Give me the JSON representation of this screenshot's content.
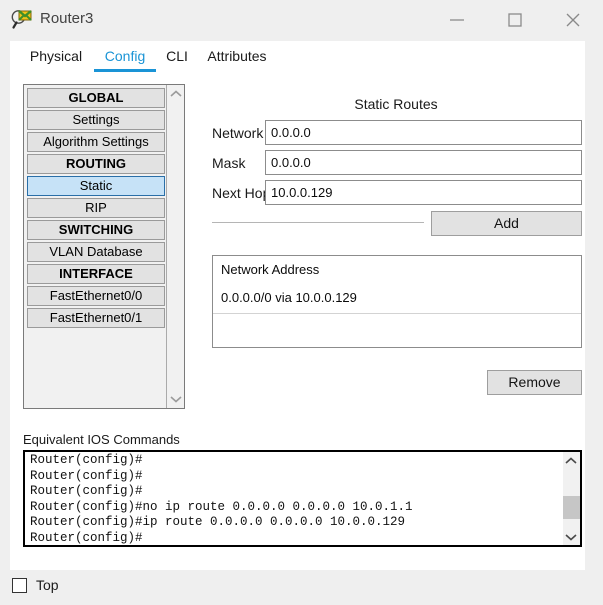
{
  "window": {
    "title": "Router3",
    "icon": "packet-tracer-icon",
    "controls": {
      "minimize": "minimize-icon",
      "maximize": "maximize-icon",
      "close": "close-icon"
    }
  },
  "tabs": [
    {
      "label": "Physical",
      "active": false
    },
    {
      "label": "Config",
      "active": true
    },
    {
      "label": "CLI",
      "active": false
    },
    {
      "label": "Attributes",
      "active": false
    }
  ],
  "sidebar": {
    "items": [
      {
        "label": "GLOBAL",
        "type": "header",
        "selected": false
      },
      {
        "label": "Settings",
        "type": "item",
        "selected": false
      },
      {
        "label": "Algorithm Settings",
        "type": "item",
        "selected": false
      },
      {
        "label": "ROUTING",
        "type": "header",
        "selected": false
      },
      {
        "label": "Static",
        "type": "item",
        "selected": true
      },
      {
        "label": "RIP",
        "type": "item",
        "selected": false
      },
      {
        "label": "SWITCHING",
        "type": "header",
        "selected": false
      },
      {
        "label": "VLAN Database",
        "type": "item",
        "selected": false
      },
      {
        "label": "INTERFACE",
        "type": "header",
        "selected": false
      },
      {
        "label": "FastEthernet0/0",
        "type": "item",
        "selected": false
      },
      {
        "label": "FastEthernet0/1",
        "type": "item",
        "selected": false
      }
    ],
    "scroll_up": "chevron-up-icon",
    "scroll_down": "chevron-down-icon"
  },
  "static_routes": {
    "title": "Static Routes",
    "fields": [
      {
        "label": "Network",
        "value": "0.0.0.0"
      },
      {
        "label": "Mask",
        "value": "0.0.0.0"
      },
      {
        "label": "Next Hop",
        "value": "10.0.0.129"
      }
    ],
    "add_label": "Add",
    "remove_label": "Remove",
    "list_header": "Network Address",
    "list_rows": [
      "0.0.0.0/0 via 10.0.0.129"
    ]
  },
  "ios": {
    "label": "Equivalent IOS Commands",
    "lines": "Router(config)#\nRouter(config)#\nRouter(config)#\nRouter(config)#no ip route 0.0.0.0 0.0.0.0 10.0.1.1\nRouter(config)#ip route 0.0.0.0 0.0.0.0 10.0.0.129\nRouter(config)#",
    "scroll_up": "chevron-up-icon",
    "scroll_down": "chevron-down-icon"
  },
  "footer": {
    "top_label": "Top",
    "top_checked": false
  },
  "colors": {
    "accent": "#1a94d6",
    "window_bg": "#efefef",
    "panel_bg": "#ffffff",
    "button_bg": "#e2e2e2",
    "selection_bg": "#c6e2f7",
    "selection_border": "#2a6fa8"
  }
}
